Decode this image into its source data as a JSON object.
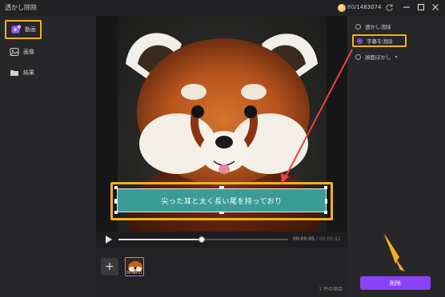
{
  "window": {
    "title": "透かし除除",
    "credits_used": "80",
    "credits_total": "/1483074"
  },
  "sidebar": {
    "items": [
      {
        "label": "動画",
        "icon": "video-plus-icon",
        "active": true
      },
      {
        "label": "画像",
        "icon": "image-icon",
        "active": false
      },
      {
        "label": "結果",
        "icon": "folder-icon",
        "active": false
      }
    ]
  },
  "preview": {
    "subtitle_text": "尖った耳と太く長い尾を持っており",
    "current_time": "00:00:05",
    "separator": " / ",
    "total_time": "00:00:11",
    "progress_fraction": 0.49
  },
  "files": {
    "add_label": "+",
    "thumb_duration": "00:00:11",
    "count_label": "1 件の項目"
  },
  "options": {
    "items": [
      {
        "label": "透かし消除",
        "selected": false
      },
      {
        "label": "字幕を消除",
        "selected": true
      },
      {
        "label": "顔面ぼかし",
        "selected": false,
        "has_dropdown": true
      }
    ]
  },
  "actions": {
    "remove_label": "削除"
  },
  "colors": {
    "accent_purple": "#8a42f5",
    "highlight_yellow": "#f2b01e",
    "subtitle_bg": "#3b9c97",
    "arrow_red": "#e8453c"
  }
}
